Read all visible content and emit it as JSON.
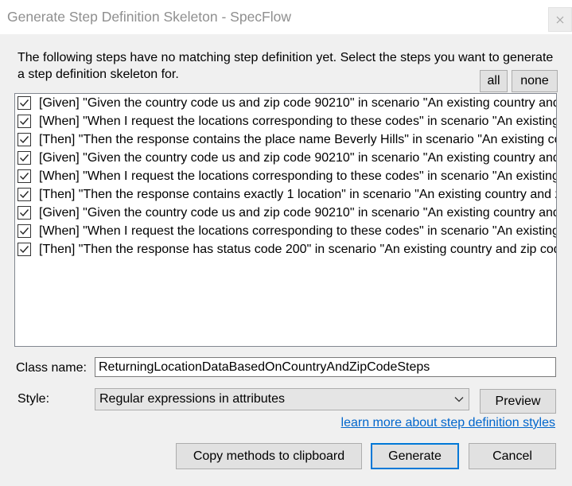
{
  "window": {
    "title": "Generate Step Definition Skeleton - SpecFlow"
  },
  "description": {
    "lines": [
      "The following steps have no matching step definition yet. Select the steps you want to generate",
      "a step definition skeleton for."
    ]
  },
  "selection": {
    "all_label": "all",
    "none_label": "none"
  },
  "steps": [
    {
      "checked": true,
      "text": "[Given] \"Given the country code us and zip code 90210\" in scenario \"An existing country and"
    },
    {
      "checked": true,
      "text": "[When] \"When I request the locations corresponding to these codes\" in scenario \"An existing"
    },
    {
      "checked": true,
      "text": "[Then] \"Then the response contains the place name Beverly Hills\" in scenario \"An existing cou"
    },
    {
      "checked": true,
      "text": "[Given] \"Given the country code us and zip code 90210\" in scenario \"An existing country and"
    },
    {
      "checked": true,
      "text": "[When] \"When I request the locations corresponding to these codes\" in scenario \"An existing"
    },
    {
      "checked": true,
      "text": "[Then] \"Then the response contains exactly 1 location\" in scenario \"An existing country and zi"
    },
    {
      "checked": true,
      "text": "[Given] \"Given the country code us and zip code 90210\" in scenario \"An existing country and"
    },
    {
      "checked": true,
      "text": "[When] \"When I request the locations corresponding to these codes\" in scenario \"An existing"
    },
    {
      "checked": true,
      "text": "[Then] \"Then the response has status code 200\" in scenario \"An existing country and zip cod"
    }
  ],
  "class_name": {
    "label": "Class name:",
    "value": "ReturningLocationDataBasedOnCountryAndZipCodeSteps"
  },
  "style": {
    "label": "Style:",
    "selected": "Regular expressions in attributes"
  },
  "preview_label": "Preview",
  "learn_more_link": "learn more about step definition styles",
  "actions": {
    "copy_label": "Copy methods to clipboard",
    "generate_label": "Generate",
    "cancel_label": "Cancel"
  },
  "icons": {
    "close": "close-icon",
    "check": "check-icon",
    "dropdown": "chevron-down-icon"
  },
  "colors": {
    "title_bar": "#ffffff",
    "dialog_background": "#f0f0f0",
    "default_button_border": "#0078d7",
    "link": "#0066cc"
  }
}
